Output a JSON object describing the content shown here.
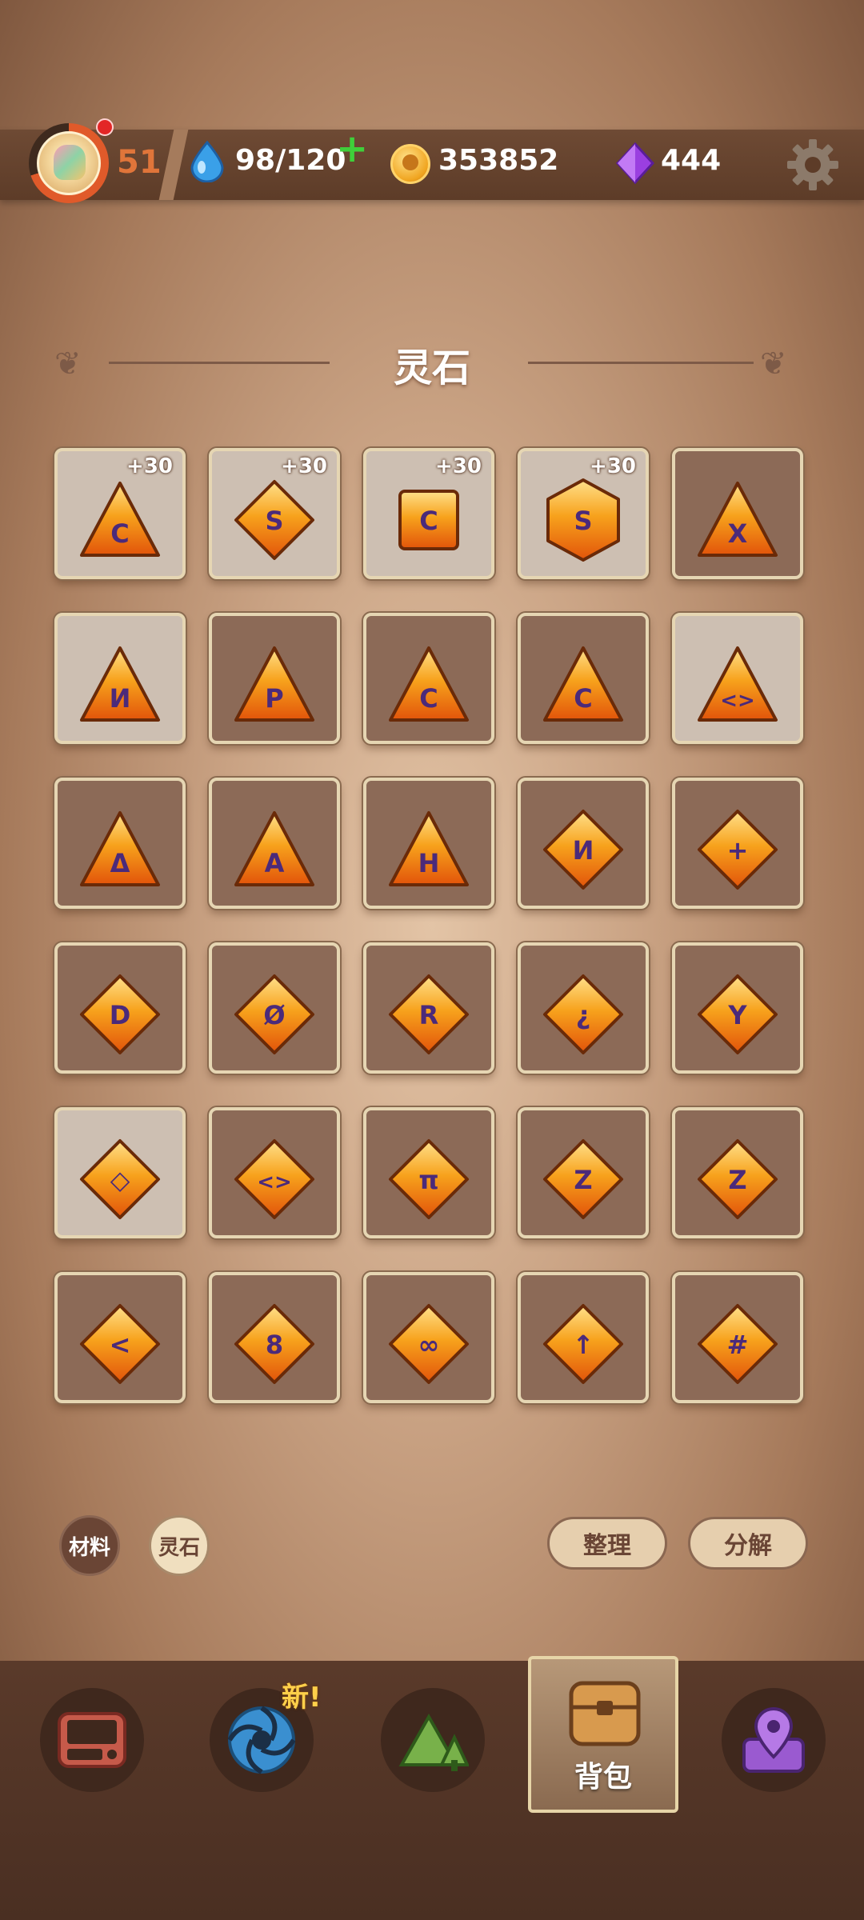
{
  "header": {
    "level": "51",
    "energy": "98/120",
    "coins": "353852",
    "gems": "444",
    "icons": [
      "avatar",
      "drop-icon",
      "plus-icon",
      "coin-icon",
      "gem-icon",
      "gear-icon"
    ]
  },
  "page": {
    "title": "灵石"
  },
  "grid": {
    "cells": [
      {
        "shape": "triangle",
        "symbol": "Ϲ",
        "bonus": "+30",
        "bg": "light"
      },
      {
        "shape": "diamond",
        "symbol": "S",
        "bonus": "+30",
        "bg": "light"
      },
      {
        "shape": "square",
        "symbol": "Ϲ",
        "bonus": "+30",
        "bg": "light"
      },
      {
        "shape": "hexagon",
        "symbol": "S",
        "bonus": "+30",
        "bg": "light"
      },
      {
        "shape": "triangle",
        "symbol": "X",
        "bonus": "",
        "bg": "dark"
      },
      {
        "shape": "triangle",
        "symbol": "И",
        "bonus": "",
        "bg": "light"
      },
      {
        "shape": "triangle",
        "symbol": "P",
        "bonus": "",
        "bg": "dark"
      },
      {
        "shape": "triangle",
        "symbol": "C",
        "bonus": "",
        "bg": "dark"
      },
      {
        "shape": "triangle",
        "symbol": "C",
        "bonus": "",
        "bg": "dark"
      },
      {
        "shape": "triangle",
        "symbol": "<>",
        "bonus": "",
        "bg": "light"
      },
      {
        "shape": "triangle",
        "symbol": "Δ",
        "bonus": "",
        "bg": "dark"
      },
      {
        "shape": "triangle",
        "symbol": "A",
        "bonus": "",
        "bg": "dark"
      },
      {
        "shape": "triangle",
        "symbol": "H",
        "bonus": "",
        "bg": "dark"
      },
      {
        "shape": "diamond",
        "symbol": "И",
        "bonus": "",
        "bg": "dark"
      },
      {
        "shape": "diamond",
        "symbol": "+",
        "bonus": "",
        "bg": "dark"
      },
      {
        "shape": "diamond",
        "symbol": "D",
        "bonus": "",
        "bg": "dark"
      },
      {
        "shape": "diamond",
        "symbol": "Ø",
        "bonus": "",
        "bg": "dark"
      },
      {
        "shape": "diamond",
        "symbol": "R",
        "bonus": "",
        "bg": "dark"
      },
      {
        "shape": "diamond",
        "symbol": "¿",
        "bonus": "",
        "bg": "dark"
      },
      {
        "shape": "diamond",
        "symbol": "Υ",
        "bonus": "",
        "bg": "dark"
      },
      {
        "shape": "diamond",
        "symbol": "◇",
        "bonus": "",
        "bg": "light"
      },
      {
        "shape": "diamond",
        "symbol": "<>",
        "bonus": "",
        "bg": "dark"
      },
      {
        "shape": "diamond",
        "symbol": "π",
        "bonus": "",
        "bg": "dark"
      },
      {
        "shape": "diamond",
        "symbol": "Z",
        "bonus": "",
        "bg": "dark"
      },
      {
        "shape": "diamond",
        "symbol": "Z",
        "bonus": "",
        "bg": "dark"
      },
      {
        "shape": "diamond",
        "symbol": "<",
        "bonus": "",
        "bg": "dark"
      },
      {
        "shape": "diamond",
        "symbol": "8",
        "bonus": "",
        "bg": "dark"
      },
      {
        "shape": "diamond",
        "symbol": "∞",
        "bonus": "",
        "bg": "dark"
      },
      {
        "shape": "diamond",
        "symbol": "↑",
        "bonus": "",
        "bg": "dark"
      },
      {
        "shape": "diamond",
        "symbol": "#",
        "bonus": "",
        "bg": "dark"
      }
    ]
  },
  "filters": {
    "materials": "材料",
    "spirit_stones": "灵石",
    "selected": "灵石"
  },
  "actions": {
    "sort": "整理",
    "decompose": "分解"
  },
  "nav": {
    "new_badge": "新!",
    "active_label": "背包",
    "items": [
      "tablet-icon",
      "portal-icon",
      "mountain-icon",
      "chest-icon",
      "location-pin-icon"
    ]
  },
  "colors": {
    "accent_orange": "#f08a12",
    "rune_purple": "#4b2a7a",
    "plus_green": "#3fcf3a",
    "level_orange": "#e0753a"
  }
}
